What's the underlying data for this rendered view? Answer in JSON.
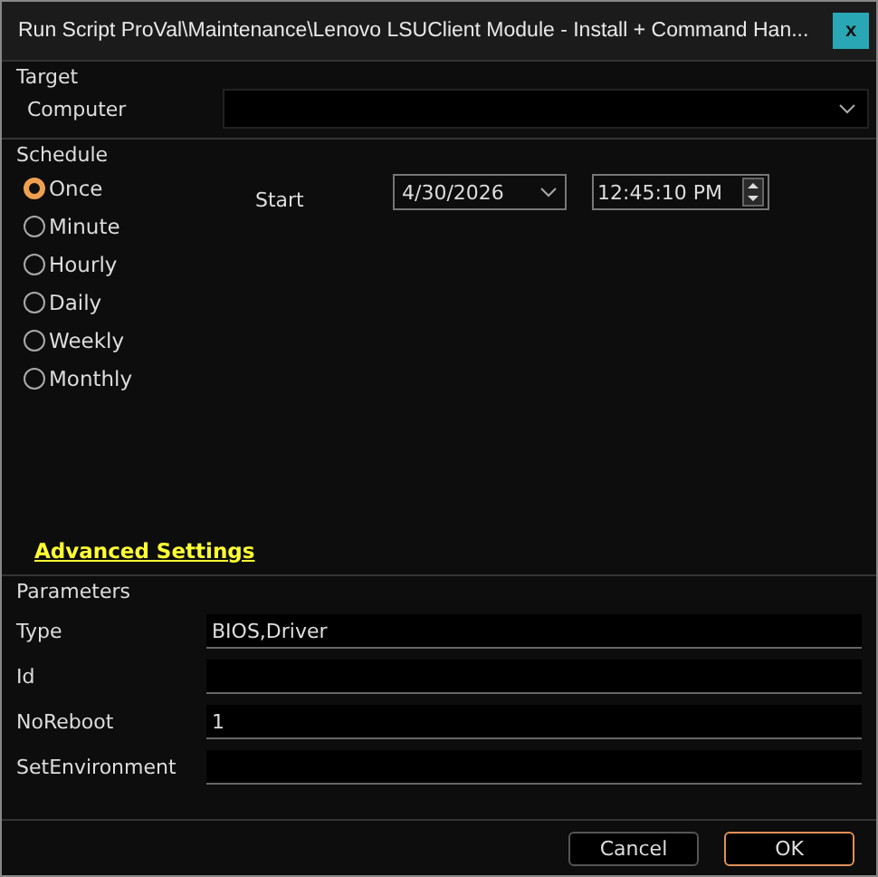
{
  "window": {
    "title": "Run Script ProVal\\Maintenance\\Lenovo LSUClient Module - Install + Command Han...",
    "close": "x"
  },
  "target": {
    "title": "Target",
    "label": "Computer"
  },
  "schedule": {
    "title": "Schedule",
    "options": [
      {
        "label": "Once",
        "selected": true
      },
      {
        "label": "Minute",
        "selected": false
      },
      {
        "label": "Hourly",
        "selected": false
      },
      {
        "label": "Daily",
        "selected": false
      },
      {
        "label": "Weekly",
        "selected": false
      },
      {
        "label": "Monthly",
        "selected": false
      }
    ],
    "start_label": "Start",
    "date": "4/30/2026",
    "time": "12:45:10 PM"
  },
  "advanced_link": "Advanced Settings",
  "parameters": {
    "title": "Parameters",
    "fields": [
      {
        "label": "Type",
        "value": "BIOS,Driver"
      },
      {
        "label": "Id"
      },
      {
        "label": "NoReboot",
        "value": "1"
      },
      {
        "label": "SetEnvironment"
      }
    ]
  },
  "buttons": [
    {
      "label": "Cancel",
      "focused": false
    },
    {
      "label": "OK",
      "focused": true
    }
  ]
}
